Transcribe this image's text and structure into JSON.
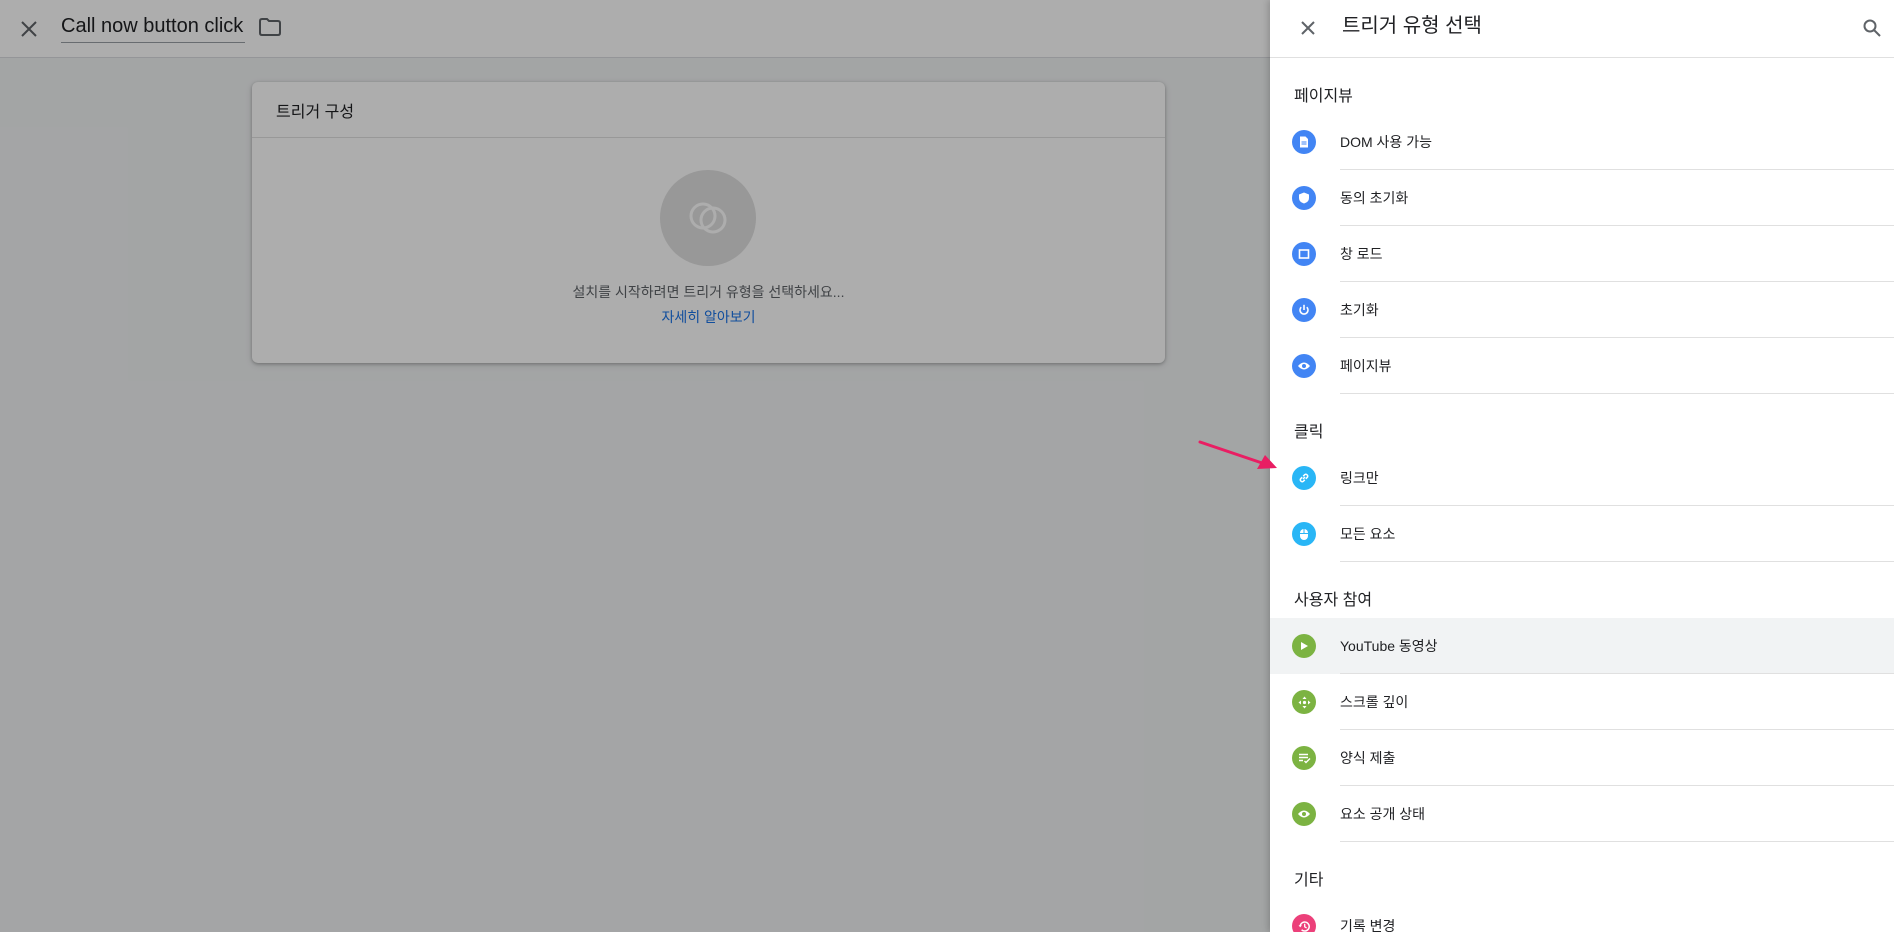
{
  "editor": {
    "title": "Call now button click",
    "card_title": "트리거 구성",
    "hint": "설치를 시작하려면 트리거 유형을 선택하세요...",
    "learn_more": "자세히 알아보기"
  },
  "panel": {
    "title": "트리거 유형 선택",
    "sections": [
      {
        "title": "페이지뷰",
        "items": [
          {
            "label": "DOM 사용 가능",
            "icon": "document-icon",
            "color": "#4285f4"
          },
          {
            "label": "동의 초기화",
            "icon": "shield-icon",
            "color": "#4285f4"
          },
          {
            "label": "창 로드",
            "icon": "window-icon",
            "color": "#4285f4"
          },
          {
            "label": "초기화",
            "icon": "power-icon",
            "color": "#4285f4"
          },
          {
            "label": "페이지뷰",
            "icon": "eye-icon",
            "color": "#4285f4"
          }
        ]
      },
      {
        "title": "클릭",
        "items": [
          {
            "label": "링크만",
            "icon": "link-icon",
            "color": "#29b6f6"
          },
          {
            "label": "모든 요소",
            "icon": "mouse-icon",
            "color": "#29b6f6"
          }
        ]
      },
      {
        "title": "사용자 참여",
        "items": [
          {
            "label": "YouTube 동영상",
            "icon": "play-icon",
            "color": "#7cb342",
            "hovered": true
          },
          {
            "label": "스크롤 깊이",
            "icon": "move-icon",
            "color": "#7cb342"
          },
          {
            "label": "양식 제출",
            "icon": "form-icon",
            "color": "#7cb342"
          },
          {
            "label": "요소 공개 상태",
            "icon": "eye-icon",
            "color": "#7cb342"
          }
        ]
      },
      {
        "title": "기타",
        "items": [
          {
            "label": "기록 변경",
            "icon": "history-icon",
            "color": "#ec407a"
          }
        ]
      }
    ]
  },
  "colors": {
    "accent": "#1a73e8",
    "annotation_arrow": "#e91e63"
  }
}
